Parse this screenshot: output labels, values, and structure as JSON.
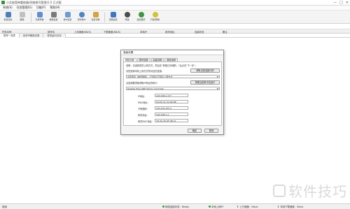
{
  "window": {
    "title": "小兵蚁宽带重拨器(网络拨号管理)1.0 正式版",
    "controls": [
      "—",
      "□",
      "✕"
    ]
  },
  "menu": [
    "系统(S)",
    "任务管理(G)",
    "功能(F)",
    "帮助(H)"
  ],
  "toolbar": [
    {
      "label": "新建任务",
      "icon": "new-task-icon",
      "color": "#4a7fc1"
    },
    {
      "label": "删除",
      "icon": "delete-icon",
      "color": "#c0c0c0"
    },
    {
      "label": "已拨号数",
      "icon": "dial-count-icon",
      "color": "#5b8fd6"
    },
    {
      "label": "重拨设置",
      "icon": "redial-settings-icon",
      "color": "#7a7a7a"
    },
    {
      "label": "换IP设置",
      "icon": "change-ip-icon",
      "color": "#6b9bd8"
    },
    {
      "label": "定时换IP",
      "icon": "timer-icon",
      "color": "#4f86c6"
    },
    {
      "label": "任务切换",
      "icon": "switch-icon",
      "color": "#d9a23a"
    },
    {
      "label": "流量监控",
      "icon": "monitor-icon",
      "color": "#3b78c4"
    },
    {
      "label": "测速",
      "icon": "speed-icon",
      "color": "#4c4c4c"
    },
    {
      "label": "退出程序",
      "icon": "exit-icon",
      "color": "#3a9a3a"
    },
    {
      "label": "升级/帮助",
      "icon": "help-icon",
      "color": "#d4c42a"
    }
  ],
  "table": {
    "columns": [
      "任务名称",
      "拨号名",
      "上传速度(KB/S)",
      "下载速度(KB/S)",
      "本地IP",
      "网关地址",
      "连接状态",
      "备注"
    ]
  },
  "tabs": [
    "拨号一览表",
    "历史IP使用记录",
    "任务运行日志"
  ],
  "status": {
    "left": "就绪",
    "net_status": "网络连接状态：Ready",
    "ip_label": "本地上网IP：",
    "up_speed": "上行速度：0kb/s",
    "down_speed": "本地下载速度：0kb/s"
  },
  "dialog": {
    "title": "高级设置",
    "tabs": [
      "网络设置",
      "拨号设置",
      "高级设置",
      "其他设置"
    ],
    "note": "说明：请选择您的上网方式，然后在“获取已存储的...”后点击“下一步”。",
    "auto_section_label": "请您选择本机上网方式所对应的连接：",
    "auto_button": "获取当前连接中的",
    "adapter1": "宽带连接（拨号网络）- 已连接(已连接)上网方式",
    "alt_section_label": "请选择要重新获取IP地址的网卡：",
    "alt_button": "获取当前网卡信息IP",
    "adapter2": "Realtek PCIe GBE Family Controller",
    "fields": [
      {
        "label": "IP地址：",
        "value": "192.168.1.177"
      },
      {
        "label": "MAC地址：",
        "value": "00-E0-4C-3A-68-8B"
      },
      {
        "label": "子网掩码：",
        "value": "255.255.255.0"
      },
      {
        "label": "网关地址：",
        "value": "192.168.1.1"
      },
      {
        "label": "网关MAC地址：",
        "value": "C8-3A-35-9F-0B-11"
      }
    ],
    "ok_button": "确定",
    "cancel_button": "取消"
  },
  "watermark": "软件技巧"
}
